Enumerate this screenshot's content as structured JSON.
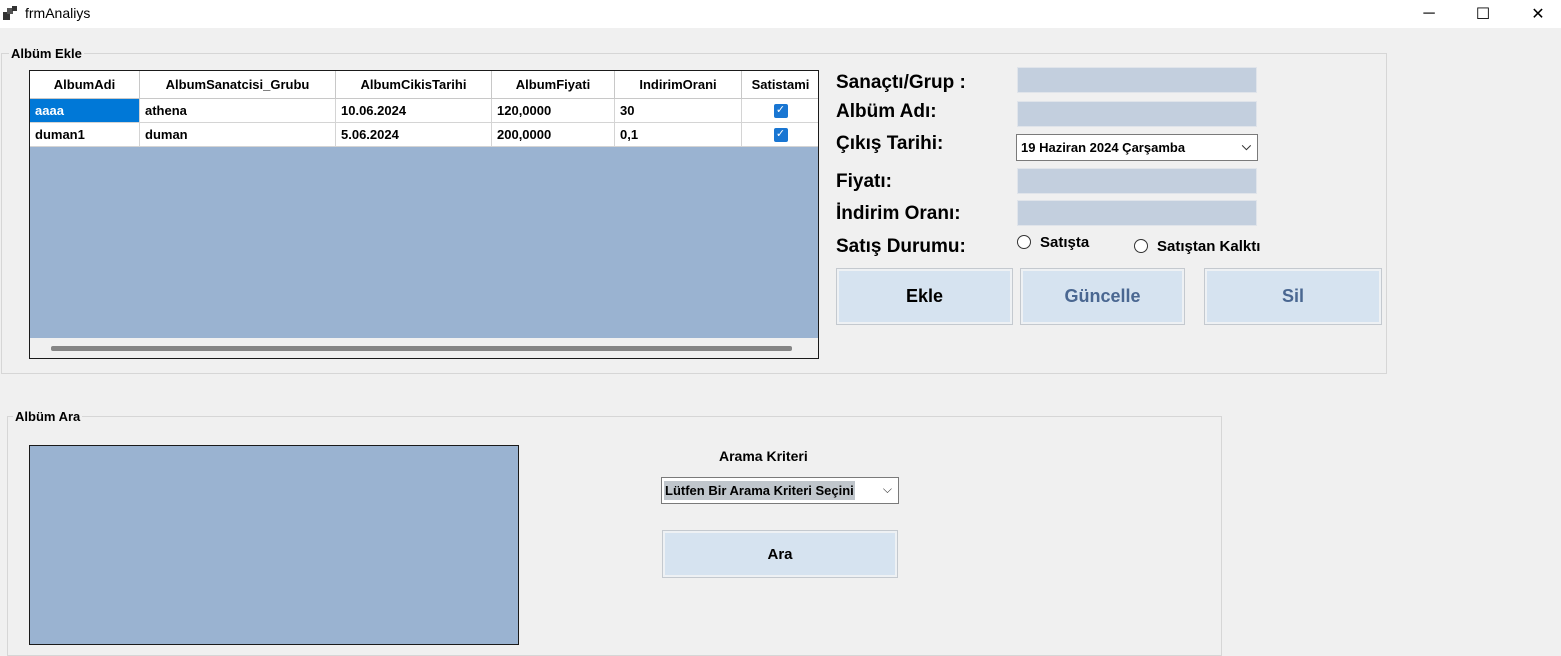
{
  "window": {
    "title": "frmAnaliys",
    "controls": {
      "minimize": "─",
      "maximize": "☐",
      "close": "✕"
    }
  },
  "add_group": {
    "label": "Albüm Ekle",
    "grid": {
      "columns": [
        "AlbumAdi",
        "AlbumSanatcisi_Grubu",
        "AlbumCikisTarihi",
        "AlbumFiyati",
        "IndirimOrani",
        "Satistami"
      ],
      "rows": [
        {
          "AlbumAdi": "aaaa",
          "AlbumSanatcisi_Grubu": "athena",
          "AlbumCikisTarihi": "10.06.2024",
          "AlbumFiyati": "120,0000",
          "IndirimOrani": "30",
          "Satistami": true
        },
        {
          "AlbumAdi": "duman1",
          "AlbumSanatcisi_Grubu": "duman",
          "AlbumCikisTarihi": "5.06.2024",
          "AlbumFiyati": "200,0000",
          "IndirimOrani": "0,1",
          "Satistami": true
        }
      ],
      "selected_row": 0
    },
    "form": {
      "artist_label": "Sanaçtı/Grup :",
      "album_label": "Albüm Adı:",
      "release_label": "Çıkış Tarihi:",
      "release_value": "19  Haziran  2024 Çarşamba",
      "price_label": "Fiyatı:",
      "discount_label": "İndirim Oranı:",
      "status_label": "Satış Durumu:",
      "radio_on_sale": "Satışta",
      "radio_off_sale": "Satıştan Kalktı"
    },
    "buttons": {
      "add": "Ekle",
      "update": "Güncelle",
      "delete": "Sil"
    }
  },
  "search_group": {
    "label": "Albüm Ara",
    "criteria_label": "Arama Kriteri",
    "criteria_value": "Lütfen Bir Arama Kriteri Seçini",
    "search_button": "Ara"
  },
  "colors": {
    "grid_background": "#9ab3d1",
    "selection": "#0078d7",
    "textbox": "#c3cfde",
    "button": "#d6e3f0",
    "button_text_blue": "#4a6791"
  }
}
